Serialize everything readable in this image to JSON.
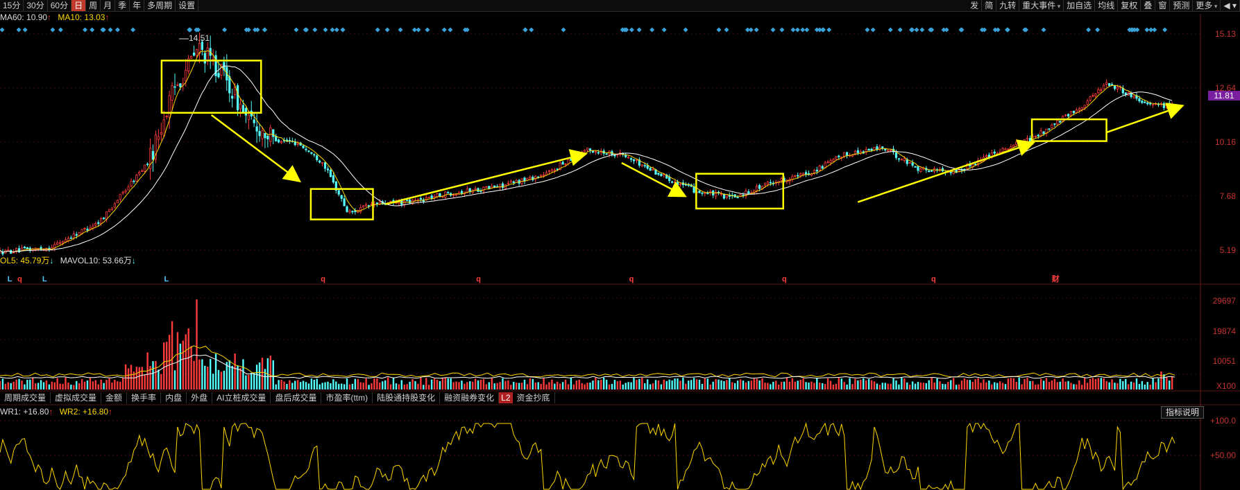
{
  "toolbar": {
    "left": [
      "15分",
      "30分",
      "60分",
      "日",
      "周",
      "月",
      "季",
      "年",
      "多周期",
      "设置"
    ],
    "active": "日",
    "right": [
      "发",
      "简",
      "九转",
      "重大事件",
      "加自选",
      "均线",
      "复权",
      "叠",
      "窗",
      "预测",
      "更多"
    ]
  },
  "legend_main": {
    "ma60_label": "MA60: 10.90",
    "ma10_label": "MA10: 13.03"
  },
  "legend_vol": {
    "vol5_label": "OL5: 45.79万",
    "mavol10_label": "MAVOL10: 53.66万"
  },
  "legend_wr": {
    "wr1_label": "WR1: +16.80",
    "wr2_label": "WR2: +16.80"
  },
  "price_axis": [
    "15.13",
    "12.64",
    "10.16",
    "7.68",
    "5.19"
  ],
  "current_price": "11.81",
  "high_label": "14.51",
  "volume_axis": [
    "29697",
    "19874",
    "10051",
    "X100"
  ],
  "wr_axis": [
    "+100.0",
    "+50.00"
  ],
  "indicator_tabs": [
    "周期成交量",
    "虚拟成交量",
    "金额",
    "换手率",
    "内盘",
    "外盘",
    "AI立桩成交量",
    "盘后成交量",
    "市盈率(ttm)",
    "陆股通持股变化",
    "融资融券变化",
    "资金抄底"
  ],
  "indicator_badge": "L2",
  "indicator_help": "指标说明",
  "event_markers": [
    "L",
    "q",
    "L",
    "L",
    "q",
    "q",
    "q",
    "q",
    "q",
    "财"
  ],
  "colors": {
    "up": "#ff3b3b",
    "down": "#54ffff",
    "ma_white": "#ffffff",
    "ma_yellow": "#ffd700",
    "annotation": "#ffff00",
    "marker": "#3aa0d8"
  },
  "chart_data": {
    "type": "candlestick",
    "title": "",
    "ylim": [
      4.2,
      15.6
    ],
    "price_series": {
      "name": "price",
      "points": [
        [
          0,
          5.1
        ],
        [
          4,
          5.3
        ],
        [
          8,
          6.5
        ],
        [
          10,
          7.9
        ],
        [
          12,
          9.3
        ],
        [
          14,
          12.6
        ],
        [
          16,
          14.5
        ],
        [
          18,
          13.2
        ],
        [
          20,
          11.1
        ],
        [
          22,
          10.3
        ],
        [
          24,
          10.1
        ],
        [
          26,
          9.2
        ],
        [
          28,
          6.9
        ],
        [
          30,
          7.3
        ],
        [
          33,
          7.4
        ],
        [
          36,
          7.8
        ],
        [
          40,
          8.1
        ],
        [
          44,
          8.7
        ],
        [
          47,
          9.8
        ],
        [
          50,
          9.6
        ],
        [
          53,
          8.7
        ],
        [
          56,
          7.9
        ],
        [
          59,
          7.6
        ],
        [
          62,
          8.3
        ],
        [
          65,
          8.7
        ],
        [
          68,
          9.6
        ],
        [
          71,
          9.9
        ],
        [
          74,
          8.9
        ],
        [
          77,
          8.8
        ],
        [
          80,
          9.7
        ],
        [
          83,
          10.3
        ],
        [
          87,
          11.8
        ],
        [
          89,
          12.9
        ],
        [
          92,
          12.0
        ],
        [
          94,
          11.8
        ]
      ]
    },
    "annotation_boxes": [
      {
        "start": 13,
        "end": 21,
        "high": 13.9,
        "low": 11.5
      },
      {
        "start": 25,
        "end": 30,
        "high": 8.0,
        "low": 6.6
      },
      {
        "start": 56,
        "end": 63,
        "high": 8.7,
        "low": 7.1
      },
      {
        "start": 83,
        "end": 89,
        "high": 11.2,
        "low": 10.2
      }
    ],
    "trend_arrows": [
      {
        "from": [
          17,
          11.4
        ],
        "to": [
          24,
          8.4
        ]
      },
      {
        "from": [
          31,
          7.3
        ],
        "to": [
          47,
          9.6
        ]
      },
      {
        "from": [
          50,
          9.2
        ],
        "to": [
          55,
          7.7
        ]
      },
      {
        "from": [
          69,
          7.4
        ],
        "to": [
          83,
          10.1
        ]
      },
      {
        "from": [
          89,
          10.6
        ],
        "to": [
          95,
          11.8
        ]
      }
    ],
    "volume": {
      "peak": 29697,
      "ticks": [
        29697,
        19874,
        10051
      ]
    },
    "wr": {
      "range": [
        0,
        100
      ],
      "current": 16.8
    }
  }
}
